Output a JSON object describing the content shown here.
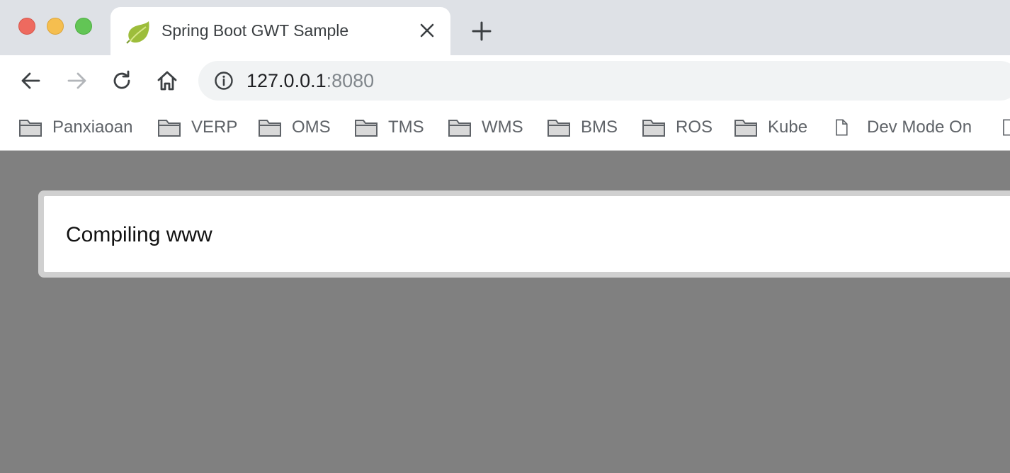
{
  "window": {
    "traffic_lights": [
      "close",
      "minimize",
      "maximize"
    ]
  },
  "tab": {
    "title": "Spring Boot GWT Sample",
    "favicon": "spring-leaf-icon"
  },
  "toolbar": {
    "url_host": "127.0.0.1",
    "url_port": ":8080"
  },
  "bookmarks": [
    {
      "label": "Panxiaoan",
      "icon": "folder-icon"
    },
    {
      "label": "VERP",
      "icon": "folder-icon"
    },
    {
      "label": "OMS",
      "icon": "folder-icon"
    },
    {
      "label": "TMS",
      "icon": "folder-icon"
    },
    {
      "label": "WMS",
      "icon": "folder-icon"
    },
    {
      "label": "BMS",
      "icon": "folder-icon"
    },
    {
      "label": "ROS",
      "icon": "folder-icon"
    },
    {
      "label": "Kube",
      "icon": "folder-icon"
    },
    {
      "label": "Dev Mode On",
      "icon": "page-icon"
    }
  ],
  "content": {
    "message": "Compiling www"
  },
  "colors": {
    "tabstrip": "#dee1e6",
    "omnibox": "#f1f3f4",
    "page_background": "#808080",
    "dialog_border": "#d0d0d0"
  }
}
